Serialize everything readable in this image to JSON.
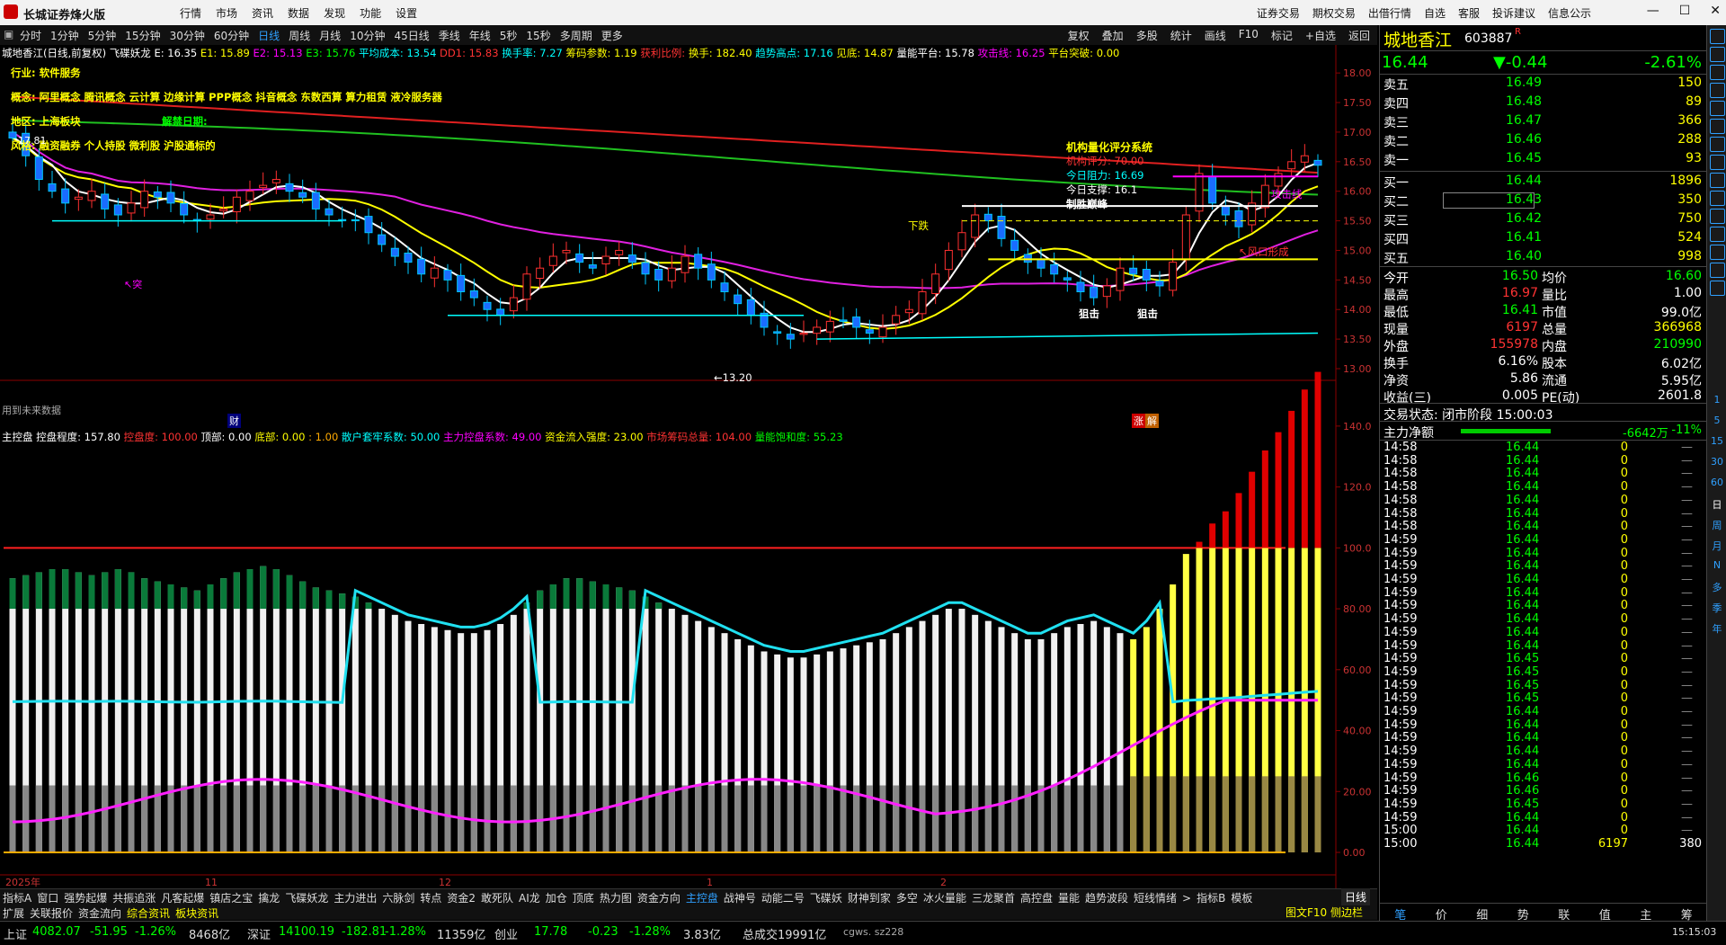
{
  "titlebar": {
    "app_title": "长城证券烽火版",
    "menus": [
      "行情",
      "市场",
      "资讯",
      "数据",
      "发现",
      "功能",
      "设置"
    ],
    "right_menus": [
      "证券交易",
      "期权交易",
      "出借行情",
      "自选",
      "客服",
      "投诉建议",
      "信息公示"
    ]
  },
  "toolbar": {
    "periods": [
      "分时",
      "1分钟",
      "5分钟",
      "15分钟",
      "30分钟",
      "60分钟",
      "日线",
      "周线",
      "月线",
      "10分钟",
      "45日线",
      "季线",
      "年线",
      "5秒",
      "15秒",
      "多周期",
      "更多"
    ],
    "active_period": "日线",
    "right_tools": [
      "复权",
      "叠加",
      "多股",
      "统计",
      "画线",
      "F10",
      "标记",
      "+自选",
      "返回"
    ]
  },
  "main_info": {
    "stock": "城地香江(日线,前复权)",
    "indicator": "飞碟妖龙",
    "e": "E: 16.35",
    "e1": "E1: 15.89",
    "e2": "E2: 15.13",
    "e3": "E3: 15.76",
    "avg_cost": "平均成本: 13.54",
    "dd1": "DD1: 15.83",
    "turnover_rate": "换手率: 7.27",
    "chip_param": "筹码参数: 1.19",
    "profit_ratio": "获利比例:",
    "turnover": "换手: 182.40",
    "trend_high": "趋势高点: 17.16",
    "bottom": "见底: 14.87",
    "vol_platform": "量能平台: 15.78",
    "attack_line": "攻击线: 16.25",
    "platform_break": "平台突破: 0.00"
  },
  "annotations": {
    "industry": "行业: 软件服务",
    "concept": "概念: 阿里概念 腾讯概念 云计算 边缘计算 PPP概念 抖音概念 东数西算 算力租赁 液冷服务器",
    "region": "地区: 上海板块",
    "unlock": "解禁日期:",
    "style": "风格: 融资融券 个人持股 微利股 沪股通标的",
    "price_tag": "17.81",
    "inst_title": "机构量化评分系统",
    "inst_score": "机构评分: 70.00",
    "resist": "今日阻力: 16.69",
    "support": "今日支撑: 16.1",
    "control": "制胜巅峰",
    "down_label": "下跌",
    "wind_open": "↖风口形成",
    "attack_line": "攻击线",
    "snipe1": "狙击",
    "snipe2": "狙击",
    "low_mark": "←13.20",
    "future_data": "用到未来数据",
    "cai": "财",
    "zhang": "涨",
    "jie": "解",
    "tu": "↖突"
  },
  "y_axis_top": [
    "18.00",
    "17.50",
    "17.00",
    "16.50",
    "16.00",
    "15.50",
    "15.00",
    "14.50",
    "14.00",
    "13.50",
    "13.00"
  ],
  "y_axis_bottom": [
    "140.0",
    "120.0",
    "100.0",
    "80.00",
    "60.00",
    "40.00",
    "20.00",
    "0.00"
  ],
  "x_axis": [
    "2025年",
    "11",
    "12",
    "1",
    "2"
  ],
  "ctrl_info": {
    "name": "主控盘",
    "degree": "控盘程度: 157.80",
    "ctrl": "控盘度: 100.00",
    "top": "顶部: 0.00",
    "bottom": "底部: 0.00",
    "one": ": 1.00",
    "retail": "散户套牢系数: 50.00",
    "main": "主力控盘系数: 49.00",
    "inflow": "资金流入强度: 23.00",
    "chip_total": "市场筹码总量: 104.00",
    "saturation": "量能饱和度: 55.23"
  },
  "tabs1": [
    "指标A",
    "窗口",
    "强势起爆",
    "共振追涨",
    "凡客起爆",
    "镇店之宝",
    "擒龙",
    "飞碟妖龙",
    "主力进出",
    "六脉剑",
    "转点",
    "资金2",
    "敢死队",
    "AI龙",
    "加仓",
    "顶底",
    "热力图",
    "资金方向",
    "主控盘",
    "战神号",
    "动能二号",
    "飞碟妖",
    "财神到家",
    "多空",
    "冰火量能",
    "三龙聚首",
    "高控盘",
    "量能",
    "趋势波段",
    "短线情绪",
    ">",
    "指标B",
    "模板"
  ],
  "tabs1_active": "主控盘",
  "tabs2": [
    "扩展",
    "关联报价",
    "资金流向",
    "综合资讯",
    "板块资讯"
  ],
  "tabs2_right": "图文F10 侧边栏",
  "period_label": "日线",
  "status": {
    "sh": "上证",
    "sh_val": "4082.07",
    "sh_chg": "-51.95",
    "sh_pct": "-1.26%",
    "sh_amt": "8468亿",
    "sz": "深证",
    "sz_val": "14100.19",
    "sz_chg": "-182.81",
    "sz_pct": "-1.28%",
    "sz_amt": "11359亿",
    "cy": "创业",
    "cy_val": "17.78",
    "cy_chg": "-0.23",
    "cy_pct": "-1.28%",
    "cy_amt": "3.83亿",
    "total": "总成交19991亿",
    "server": "cgws. sz228",
    "time": "15:15:03"
  },
  "quote": {
    "name": "城地香江",
    "code": "603887",
    "price": "16.44",
    "change": "▼-0.44",
    "pct": "-2.61%",
    "asks": [
      {
        "label": "卖五",
        "price": "16.49",
        "vol": "150"
      },
      {
        "label": "卖四",
        "price": "16.48",
        "vol": "89"
      },
      {
        "label": "卖三",
        "price": "16.47",
        "vol": "366"
      },
      {
        "label": "卖二",
        "price": "16.46",
        "vol": "288"
      },
      {
        "label": "卖一",
        "price": "16.45",
        "vol": "93"
      }
    ],
    "bids": [
      {
        "label": "买一",
        "price": "16.44",
        "vol": "1896"
      },
      {
        "label": "买二",
        "price": "16.43",
        "vol": "350"
      },
      {
        "label": "买三",
        "price": "16.42",
        "vol": "750"
      },
      {
        "label": "买四",
        "price": "16.41",
        "vol": "524"
      },
      {
        "label": "买五",
        "price": "16.40",
        "vol": "998"
      }
    ],
    "stats": [
      {
        "l1": "今开",
        "v1": "16.50",
        "l2": "均价",
        "v2": "16.60"
      },
      {
        "l1": "最高",
        "v1": "16.97",
        "l2": "量比",
        "v2": "1.00"
      },
      {
        "l1": "最低",
        "v1": "16.41",
        "l2": "市值",
        "v2": "99.0亿"
      },
      {
        "l1": "现量",
        "v1": "6197",
        "l2": "总量",
        "v2": "366968"
      },
      {
        "l1": "外盘",
        "v1": "155978",
        "l2": "内盘",
        "v2": "210990"
      },
      {
        "l1": "换手",
        "v1": "6.16%",
        "l2": "股本",
        "v2": "6.02亿"
      },
      {
        "l1": "净资",
        "v1": "5.86",
        "l2": "流通",
        "v2": "5.95亿"
      },
      {
        "l1": "收益(三)",
        "v1": "0.005",
        "l2": "PE(动)",
        "v2": "2601.8"
      }
    ],
    "trade_state": "交易状态: 闭市阶段 15:00:03",
    "net_main_label": "主力净额",
    "net_main_val": "-6642万",
    "net_main_pct": "-11%",
    "ticks": [
      {
        "t": "14:58",
        "p": "16.44",
        "v": "0"
      },
      {
        "t": "14:58",
        "p": "16.44",
        "v": "0"
      },
      {
        "t": "14:58",
        "p": "16.44",
        "v": "0"
      },
      {
        "t": "14:58",
        "p": "16.44",
        "v": "0"
      },
      {
        "t": "14:58",
        "p": "16.44",
        "v": "0"
      },
      {
        "t": "14:58",
        "p": "16.44",
        "v": "0"
      },
      {
        "t": "14:58",
        "p": "16.44",
        "v": "0"
      },
      {
        "t": "14:59",
        "p": "16.44",
        "v": "0"
      },
      {
        "t": "14:59",
        "p": "16.44",
        "v": "0"
      },
      {
        "t": "14:59",
        "p": "16.44",
        "v": "0"
      },
      {
        "t": "14:59",
        "p": "16.44",
        "v": "0"
      },
      {
        "t": "14:59",
        "p": "16.44",
        "v": "0"
      },
      {
        "t": "14:59",
        "p": "16.44",
        "v": "0"
      },
      {
        "t": "14:59",
        "p": "16.44",
        "v": "0"
      },
      {
        "t": "14:59",
        "p": "16.44",
        "v": "0"
      },
      {
        "t": "14:59",
        "p": "16.44",
        "v": "0"
      },
      {
        "t": "14:59",
        "p": "16.45",
        "v": "0"
      },
      {
        "t": "14:59",
        "p": "16.45",
        "v": "0"
      },
      {
        "t": "14:59",
        "p": "16.45",
        "v": "0"
      },
      {
        "t": "14:59",
        "p": "16.45",
        "v": "0"
      },
      {
        "t": "14:59",
        "p": "16.44",
        "v": "0"
      },
      {
        "t": "14:59",
        "p": "16.44",
        "v": "0"
      },
      {
        "t": "14:59",
        "p": "16.44",
        "v": "0"
      },
      {
        "t": "14:59",
        "p": "16.44",
        "v": "0"
      },
      {
        "t": "14:59",
        "p": "16.44",
        "v": "0"
      },
      {
        "t": "14:59",
        "p": "16.46",
        "v": "0"
      },
      {
        "t": "14:59",
        "p": "16.46",
        "v": "0"
      },
      {
        "t": "14:59",
        "p": "16.45",
        "v": "0"
      },
      {
        "t": "14:59",
        "p": "16.44",
        "v": "0"
      },
      {
        "t": "15:00",
        "p": "16.44",
        "v": "0"
      },
      {
        "t": "15:00",
        "p": "16.44",
        "v": "6197",
        "v2": "380"
      }
    ],
    "bottom_tabs": [
      "笔",
      "价",
      "细",
      "势",
      "联",
      "值",
      "主",
      "筹"
    ]
  },
  "sidebar": [
    "1",
    "5",
    "15",
    "30",
    "60",
    "日",
    "周",
    "月",
    "N",
    "多",
    "季",
    "年"
  ],
  "colors": {
    "up": "#ff3030",
    "down": "#00ffff",
    "bg": "#000000",
    "accent": "#2fa0ff",
    "yellow": "#ffff00",
    "magenta": "#ff00ff"
  },
  "chart_data": [
    {
      "type": "candlestick",
      "title": "城地香江(日线,前复权)",
      "ylim": [
        13.0,
        18.2
      ],
      "x_ticks": [
        "2025年",
        "11",
        "12",
        "1",
        "2"
      ],
      "close_series_approx": [
        16.9,
        16.6,
        16.2,
        16.0,
        15.8,
        15.9,
        16.0,
        15.7,
        15.6,
        15.8,
        16.0,
        15.9,
        15.8,
        15.6,
        15.5,
        15.6,
        15.7,
        15.9,
        16.0,
        16.1,
        16.2,
        16.0,
        15.9,
        15.7,
        15.6,
        15.5,
        15.5,
        15.3,
        15.1,
        14.9,
        14.8,
        14.6,
        14.7,
        14.5,
        14.3,
        14.2,
        14.0,
        13.9,
        14.2,
        14.6,
        14.7,
        14.9,
        15.0,
        14.8,
        14.7,
        14.9,
        15.0,
        14.8,
        14.6,
        14.5,
        14.7,
        14.9,
        14.7,
        14.5,
        14.3,
        14.1,
        13.9,
        13.7,
        13.6,
        13.5,
        13.6,
        13.7,
        13.8,
        13.8,
        13.7,
        13.6,
        13.7,
        13.9,
        14.0,
        14.3,
        14.6,
        15.0,
        15.3,
        15.6,
        15.5,
        15.2,
        15.0,
        14.8,
        14.7,
        14.6,
        14.5,
        14.3,
        14.2,
        14.4,
        14.7,
        14.6,
        14.5,
        14.4,
        14.8,
        15.6,
        16.3,
        15.8,
        15.6,
        15.4,
        15.8,
        16.1,
        16.3,
        16.5,
        16.6,
        16.44
      ]
    },
    {
      "type": "bar",
      "title": "主控盘",
      "ylim": [
        0,
        150
      ],
      "values_approx": [
        90,
        91,
        92,
        93,
        93,
        92,
        91,
        92,
        93,
        92,
        90,
        89,
        88,
        87,
        86,
        88,
        90,
        92,
        93,
        94,
        93,
        91,
        89,
        87,
        86,
        85,
        84,
        82,
        80,
        78,
        76,
        75,
        74,
        73,
        72,
        72,
        73,
        75,
        78,
        82,
        86,
        88,
        90,
        90,
        89,
        88,
        87,
        86,
        84,
        82,
        80,
        78,
        76,
        74,
        72,
        70,
        68,
        66,
        65,
        64,
        64,
        65,
        66,
        67,
        68,
        69,
        70,
        72,
        74,
        76,
        78,
        80,
        80,
        78,
        76,
        74,
        72,
        70,
        70,
        72,
        74,
        75,
        76,
        74,
        72,
        70,
        74,
        80,
        88,
        98,
        102,
        108,
        112,
        118,
        125,
        132,
        138,
        145,
        152,
        157.8
      ]
    }
  ]
}
